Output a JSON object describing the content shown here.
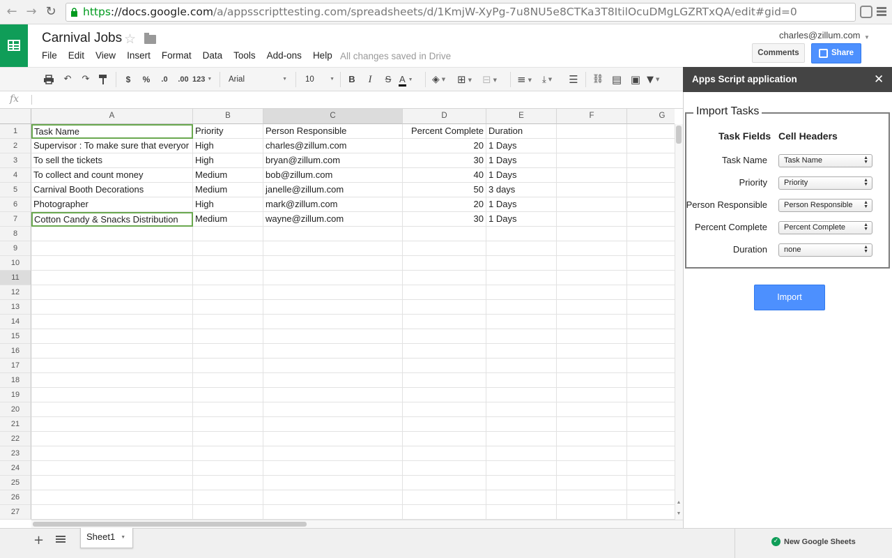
{
  "browser": {
    "url_scheme": "https",
    "url_host": "://docs.google.com",
    "url_path": "/a/appsscripttesting.com/spreadsheets/d/1KmjW-XyPg-7u8NU5e8CTKa3T8ItilOcuDMgLGZRTxQA/edit#gid=0"
  },
  "doc": {
    "title": "Carnival Jobs",
    "menus": [
      "File",
      "Edit",
      "View",
      "Insert",
      "Format",
      "Data",
      "Tools",
      "Add-ons",
      "Help"
    ],
    "save_status": "All changes saved in Drive",
    "user": "charles@zillum.com",
    "comments_label": "Comments",
    "share_label": "Share"
  },
  "toolbar": {
    "currency": "$",
    "percent": "%",
    "dec_decrease": ".0",
    "dec_increase": ".00",
    "more_formats": "123",
    "font": "Arial",
    "font_size": "10",
    "bold": "B",
    "italic": "I",
    "strike": "S",
    "text_color": "A"
  },
  "formula_bar": {
    "label": "fx",
    "value": ""
  },
  "grid": {
    "columns": [
      "A",
      "B",
      "C",
      "D",
      "E",
      "F",
      "G"
    ],
    "rows": [
      "1",
      "2",
      "3",
      "4",
      "5",
      "6",
      "7",
      "8",
      "9",
      "10",
      "11",
      "12",
      "13",
      "14",
      "15",
      "16",
      "17",
      "18",
      "19",
      "20",
      "21",
      "22",
      "23",
      "24",
      "25",
      "26",
      "27"
    ],
    "selected_row": "11",
    "selected_column": "C",
    "cells": [
      [
        "Task Name",
        "Priority",
        "Person Responsible",
        "Percent Complete",
        "Duration"
      ],
      [
        "Supervisor : To make sure that everyor",
        "High",
        "charles@zillum.com",
        "20",
        "1 Days"
      ],
      [
        "To sell the tickets",
        "High",
        "bryan@zillum.com",
        "30",
        "1 Days"
      ],
      [
        "To collect and count money",
        "Medium",
        "bob@zillum.com",
        "40",
        "1 Days"
      ],
      [
        "Carnival Booth Decorations",
        "Medium",
        "janelle@zillum.com",
        "50",
        "3 days"
      ],
      [
        "Photographer",
        "High",
        "mark@zillum.com",
        "20",
        "1 Days"
      ],
      [
        "Cotton Candy & Snacks Distribution",
        "Medium",
        "wayne@zillum.com",
        "30",
        "1 Days"
      ]
    ]
  },
  "sheets": {
    "active_tab": "Sheet1",
    "new_sheets_label": "New Google Sheets"
  },
  "sidebar": {
    "title": "Apps Script application",
    "close_glyph": "✕",
    "legend": "Import Tasks",
    "col1_header": "Task Fields",
    "col2_header": "Cell Headers",
    "fields": [
      {
        "label": "Task Name",
        "value": "Task Name"
      },
      {
        "label": "Priority",
        "value": "Priority"
      },
      {
        "label": "Person Responsible",
        "value": "Person Responsible"
      },
      {
        "label": "Percent Complete",
        "value": "Percent Complete"
      },
      {
        "label": "Duration",
        "value": "none"
      }
    ],
    "import_label": "Import"
  },
  "colors": {
    "sheets_green": "#0f9d58",
    "share_blue": "#4d90fe",
    "sidebar_header": "#444444",
    "selection_green": "#6aa84f"
  }
}
